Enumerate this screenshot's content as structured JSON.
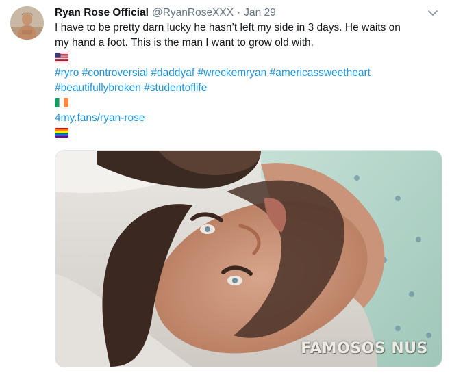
{
  "tweet": {
    "display_name": "Ryan Rose Official",
    "handle": "@RyanRoseXXX",
    "separator": "·",
    "date": "Jan 29",
    "text_lines": [
      "I have to be pretty darn lucky he hasn’t left my side in 3 days. He waits on",
      "my hand a foot. This is the man I want to grow old with."
    ],
    "hashtags_lines": [
      "#ryro #controversial #daddyaf #wreckemryan #americassweetheart",
      "#beautifullybroken #studentoflife"
    ],
    "link": "4my.fans/ryan-rose",
    "flags": [
      "us-flag",
      "ireland-flag",
      "rainbow-flag"
    ],
    "media": {
      "watermark": "FAMOSOS NUS"
    }
  },
  "colors": {
    "link_blue": "#1b95e0",
    "secondary_text": "#657786",
    "primary_text": "#14171a"
  }
}
